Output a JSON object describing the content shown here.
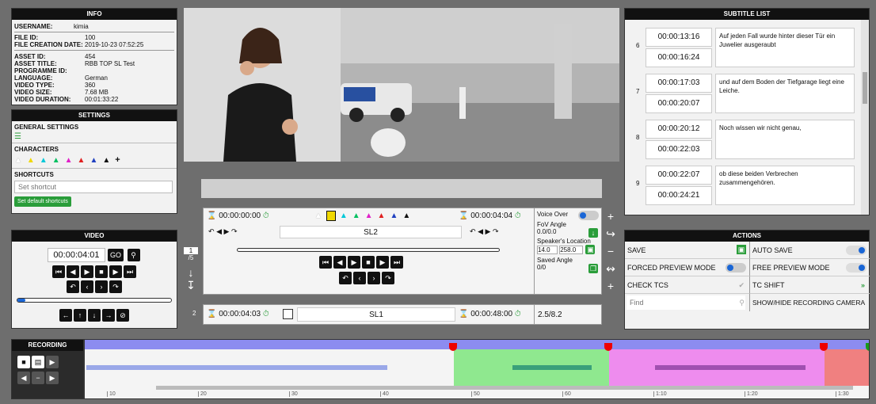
{
  "info": {
    "header": "INFO",
    "username_label": "USERNAME:",
    "username": "kimia",
    "file_id_label": "FILE ID:",
    "file_id": "100",
    "created_label": "FILE CREATION DATE:",
    "created": "2019-10-23 07:52:25",
    "asset_id_label": "ASSET ID:",
    "asset_id": "454",
    "asset_title_label": "ASSET TITLE:",
    "asset_title": "RBB TOP SL Test",
    "programme_label": "PROGRAMME ID:",
    "programme": "",
    "language_label": "LANGUAGE:",
    "language": "German",
    "video_type_label": "VIDEO TYPE:",
    "video_type": "360",
    "video_size_label": "VIDEO SIZE:",
    "video_size": "7.68 MB",
    "duration_label": "VIDEO DURATION:",
    "duration": "00:01:33:22"
  },
  "settings": {
    "header": "SETTINGS",
    "general_label": "GENERAL SETTINGS",
    "characters_label": "CHARACTERS",
    "character_colors": [
      "#ffffff",
      "#f0d800",
      "#00c8d8",
      "#00c060",
      "#e020c8",
      "#e02020",
      "#2040c0",
      "#111111"
    ],
    "add_character": "+",
    "shortcuts_label": "SHORTCUTS",
    "shortcut_placeholder": "Set shortcut",
    "default_shortcuts": "Set default shortcuts"
  },
  "video": {
    "header": "VIDEO",
    "timecode": "00:00:04:01",
    "go": "GO",
    "progress": 0.05
  },
  "subtitle_list": {
    "header": "SUBTITLE LIST",
    "rows": [
      {
        "num": "6",
        "start": "00:00:13:16",
        "end": "00:00:16:24",
        "text": "Auf jeden Fall wurde hinter dieser Tür ein Juwelier ausgeraubt"
      },
      {
        "num": "7",
        "start": "00:00:17:03",
        "end": "00:00:20:07",
        "text": "und auf dem Boden der Tiefgarage liegt eine Leiche."
      },
      {
        "num": "8",
        "start": "00:00:20:12",
        "end": "00:00:22:03",
        "text": "Noch wissen wir nicht genau,"
      },
      {
        "num": "9",
        "start": "00:00:22:07",
        "end": "00:00:24:21",
        "text": "ob diese beiden Verbrechen zusammengehören."
      }
    ]
  },
  "editor": {
    "page": "1",
    "page_total": "/5",
    "row1": {
      "num": "1",
      "start": "00:00:00:00",
      "end": "00:00:04:04",
      "label_left": "SL2",
      "label_right": "SL2"
    },
    "row2": {
      "num": "2",
      "start": "00:00:04:03",
      "end": "00:00:48:00",
      "label": "SL1",
      "ratio": "2.5/8.2"
    },
    "voice_over": "Voice Over",
    "fov_label": "FoV Angle",
    "fov": "0.0/0.0",
    "speaker_label": "Speaker's Location",
    "speaker_a": "14.0",
    "speaker_b": "258.0",
    "saved_label": "Saved Angle",
    "saved": "0/0"
  },
  "actions": {
    "header": "ACTIONS",
    "save": "SAVE",
    "auto_save": "AUTO SAVE",
    "forced_preview": "FORCED PREVIEW MODE",
    "free_preview": "FREE PREVIEW MODE",
    "check_tcs": "CHECK TCS",
    "tc_shift": "TC SHIFT",
    "find_placeholder": "Find",
    "show_hide": "SHOW/HIDE RECORDING CAMERA"
  },
  "recording": {
    "header": "RECORDING",
    "ticks": [
      "10",
      "20",
      "30",
      "40",
      "50",
      "60",
      "1:10",
      "1:20",
      "1:30"
    ]
  },
  "colors": {
    "accent": "#1a66d6",
    "green_region": "#8fe88f",
    "pink_region": "#ee8cee",
    "red_region": "#f08080"
  }
}
